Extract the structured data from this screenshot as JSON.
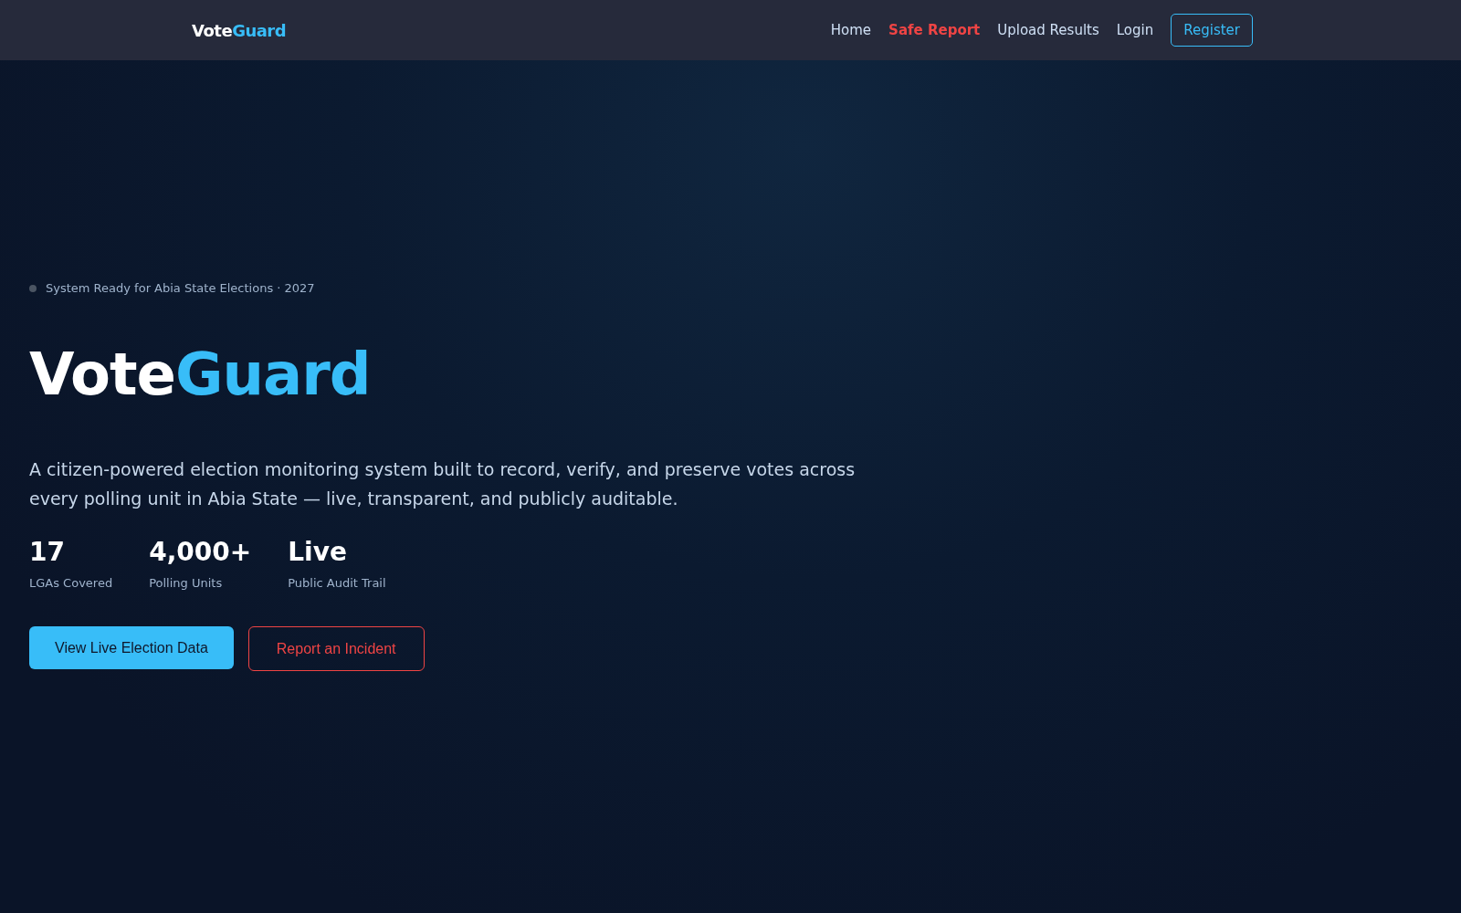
{
  "nav": {
    "logo": [
      {
        "text": "Vote",
        "kind": "plain"
      },
      {
        "text": "Guard",
        "kind": "accent"
      }
    ],
    "links": [
      {
        "label": "Home",
        "kind": "link"
      },
      {
        "label": "Safe Report",
        "kind": "alert"
      },
      {
        "label": "Upload Results",
        "kind": "link"
      },
      {
        "label": "Login",
        "kind": "link"
      },
      {
        "label": "Register",
        "kind": "outline"
      }
    ]
  },
  "hero": {
    "badge": "System Ready for Abia State Elections · 2027",
    "title": [
      {
        "text": "Vote",
        "kind": "plain"
      },
      {
        "text": "Guard",
        "kind": "accent"
      }
    ],
    "description": "A citizen-powered election monitoring system built to record, verify, and preserve votes across every polling unit in Abia State — live, transparent, and publicly auditable.",
    "stats": [
      {
        "value": "17",
        "label": "LGAs Covered"
      },
      {
        "value": "4,000+",
        "label": "Polling Units"
      },
      {
        "value": "Live",
        "label": "Public Audit Trail"
      }
    ],
    "buttons": [
      {
        "label": "View Live Election Data",
        "kind": "primary"
      },
      {
        "label": "Report an Incident",
        "kind": "danger"
      }
    ]
  }
}
